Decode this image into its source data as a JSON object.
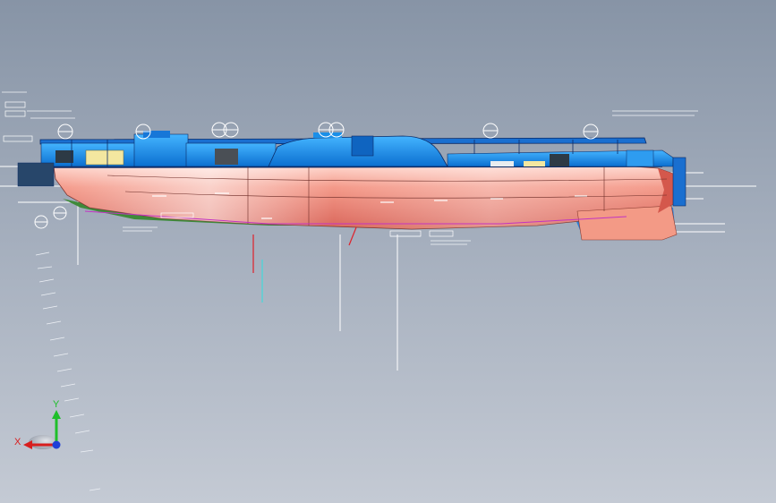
{
  "viewport": {
    "background_top": "#8794a6",
    "background_bottom": "#c4cad4"
  },
  "model": {
    "hull_color": "#f08a7a",
    "hull_highlight": "#ffd9d0",
    "superstructure_color": "#1a8fe8",
    "superstructure_dark": "#0b5cb0",
    "deck_line_color": "#0b2a66",
    "section_line_color": "#ffffff",
    "red_guide_color": "#e0202a",
    "cyan_guide_color": "#30e0e0",
    "yellow_panel_color": "#f3e7a0"
  },
  "triad": {
    "x_label": "X",
    "y_label": "Y",
    "x_color": "#d81e1e",
    "y_color": "#1fbf2a",
    "z_color": "#1f3fd8",
    "cone_color": "#b7bcc6"
  }
}
